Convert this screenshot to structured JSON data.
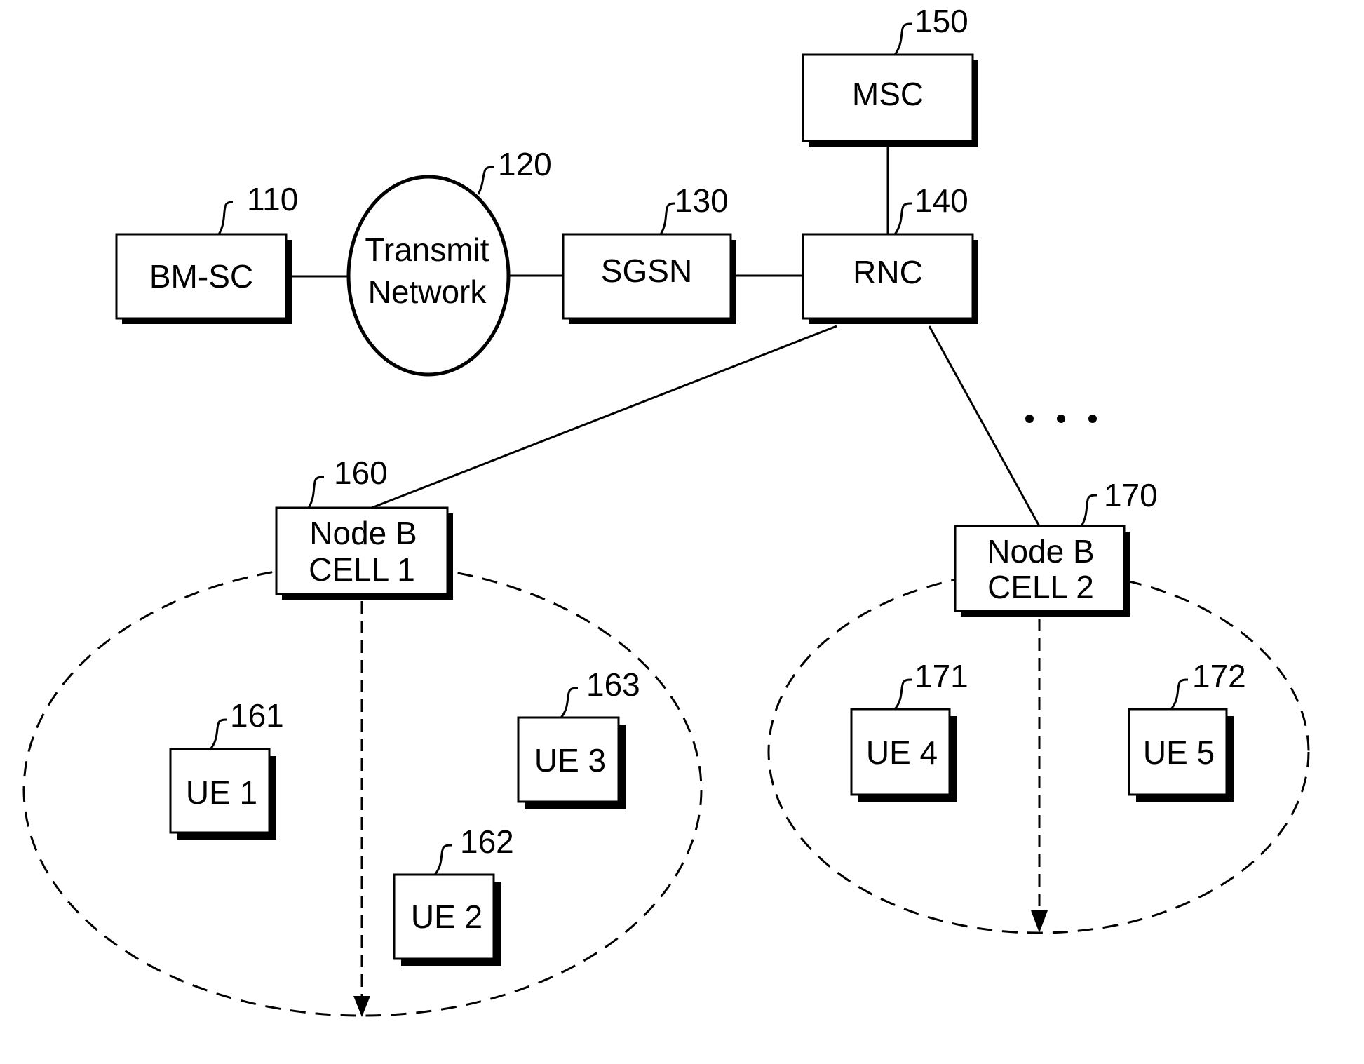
{
  "diagram": {
    "nodes": {
      "bmsc": {
        "label": "BM-SC",
        "ref": "110"
      },
      "transmit": {
        "line1": "Transmit",
        "line2": "Network",
        "ref": "120"
      },
      "sgsn": {
        "label": "SGSN",
        "ref": "130"
      },
      "rnc": {
        "label": "RNC",
        "ref": "140"
      },
      "msc": {
        "label": "MSC",
        "ref": "150"
      },
      "nodeb1": {
        "line1": "Node B",
        "line2": "CELL 1",
        "ref": "160"
      },
      "nodeb2": {
        "line1": "Node B",
        "line2": "CELL 2",
        "ref": "170"
      },
      "ue1": {
        "label": "UE 1",
        "ref": "161"
      },
      "ue2": {
        "label": "UE 2",
        "ref": "162"
      },
      "ue3": {
        "label": "UE 3",
        "ref": "163"
      },
      "ue4": {
        "label": "UE 4",
        "ref": "171"
      },
      "ue5": {
        "label": "UE 5",
        "ref": "172"
      }
    },
    "ellipsis": "• • •",
    "colors": {
      "stroke": "#000000",
      "background": "#ffffff"
    }
  }
}
